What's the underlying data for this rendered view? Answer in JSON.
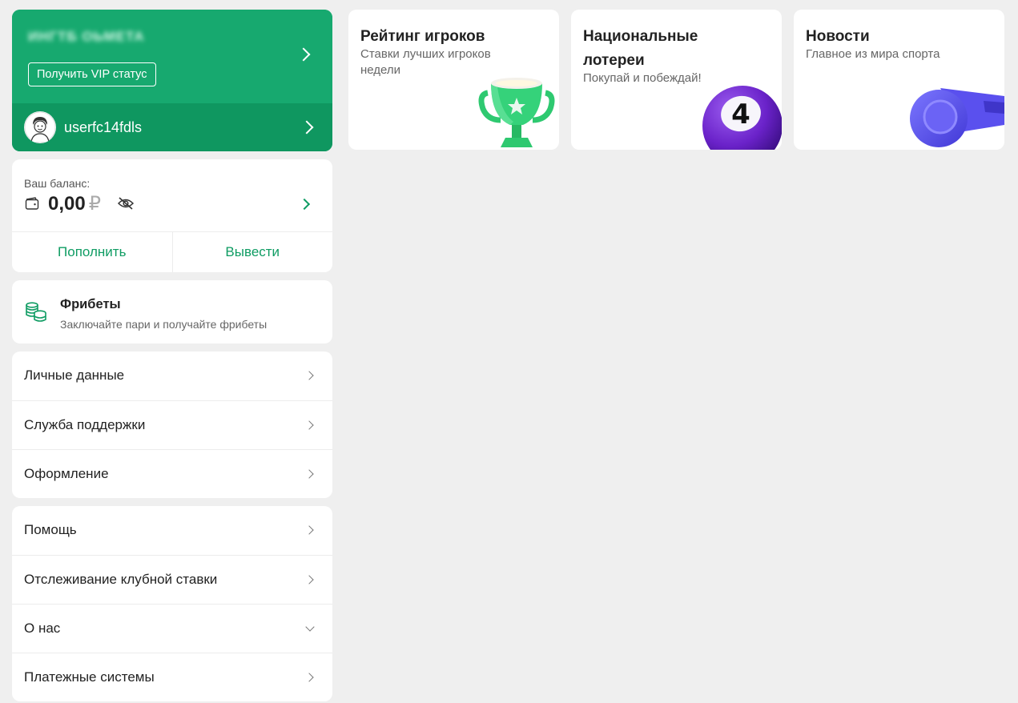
{
  "profile": {
    "blurred_name": "ИНГТБ ОЬМЕТА",
    "vip_button": "Получить VIP статус",
    "username": "userfc14fdls"
  },
  "balance": {
    "label": "Ваш баланс:",
    "amount": "0,00",
    "currency": "₽",
    "deposit": "Пополнить",
    "withdraw": "Вывести"
  },
  "freebets": {
    "title": "Фрибеты",
    "subtitle": "Заключайте пари и получайте фрибеты"
  },
  "menu1": [
    {
      "label": "Личные данные"
    },
    {
      "label": "Служба поддержки"
    },
    {
      "label": "Оформление"
    }
  ],
  "menu2": [
    {
      "label": "Помощь"
    },
    {
      "label": "Отслеживание клубной ставки"
    },
    {
      "label": "О нас"
    },
    {
      "label": "Платежные системы"
    }
  ],
  "tiles": [
    {
      "title": "Рейтинг игроков",
      "subtitle": "Ставки лучших игроков недели",
      "icon": "trophy-icon"
    },
    {
      "title": "Национальные лотереи",
      "subtitle": "Покупай и побеждай!",
      "icon": "lottery-ball-icon",
      "ball_number": "4"
    },
    {
      "title": "Новости",
      "subtitle": "Главное из мира спорта",
      "icon": "whistle-icon"
    }
  ],
  "colors": {
    "brand_green": "#17a96f",
    "brand_green_dark": "#0f9760",
    "accent_text": "#0f9c63",
    "background": "#efefef"
  }
}
